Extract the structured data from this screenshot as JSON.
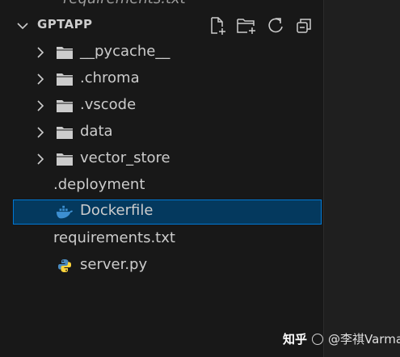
{
  "explorer": {
    "cut_off_item": "requirements.txt",
    "section_title": "GPTAPP",
    "actions": [
      {
        "name": "new-file",
        "icon": "new-file-icon"
      },
      {
        "name": "new-folder",
        "icon": "new-folder-icon"
      },
      {
        "name": "refresh",
        "icon": "refresh-icon"
      },
      {
        "name": "collapse-all",
        "icon": "collapse-all-icon"
      }
    ],
    "items": [
      {
        "label": "__pycache__",
        "type": "folder",
        "expanded": false
      },
      {
        "label": ".chroma",
        "type": "folder",
        "expanded": false
      },
      {
        "label": ".vscode",
        "type": "folder",
        "expanded": false
      },
      {
        "label": "data",
        "type": "folder",
        "expanded": false
      },
      {
        "label": "vector_store",
        "type": "folder",
        "expanded": false
      },
      {
        "label": ".deployment",
        "type": "file",
        "icon": "none"
      },
      {
        "label": "Dockerfile",
        "type": "file",
        "icon": "docker-icon",
        "selected": true
      },
      {
        "label": "requirements.txt",
        "type": "file",
        "icon": "none"
      },
      {
        "label": "server.py",
        "type": "file",
        "icon": "python-icon"
      }
    ]
  },
  "watermark": {
    "platform": "知乎",
    "author": "@李祺Varman"
  },
  "colors": {
    "sidebar_bg": "#181818",
    "selection_bg": "#04395e",
    "selection_border": "#0078d4",
    "text": "#cccccc",
    "docker_blue": "#3d8fd1",
    "python_blue": "#4b8bbe",
    "python_yellow": "#ffd43b"
  }
}
